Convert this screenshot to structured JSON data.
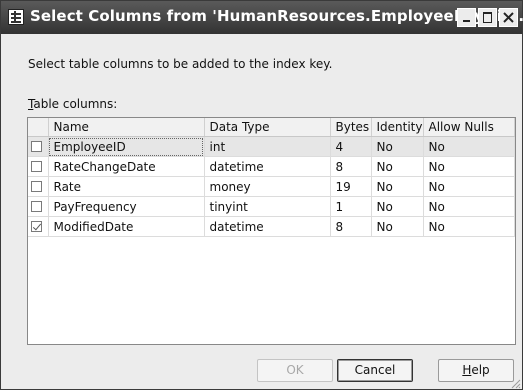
{
  "window": {
    "title": "Select Columns from 'HumanResources.EmployeePayHist..."
  },
  "instruction": "Select table columns to be added to the index key.",
  "table_label": {
    "accel": "T",
    "rest": "able columns:"
  },
  "grid": {
    "headers": [
      "",
      "Name",
      "Data Type",
      "Bytes",
      "Identity",
      "Allow Nulls"
    ],
    "rows": [
      {
        "checked": false,
        "name": "EmployeeID",
        "type": "int",
        "bytes": "4",
        "identity": "No",
        "nulls": "No"
      },
      {
        "checked": false,
        "name": "RateChangeDate",
        "type": "datetime",
        "bytes": "8",
        "identity": "No",
        "nulls": "No"
      },
      {
        "checked": false,
        "name": "Rate",
        "type": "money",
        "bytes": "19",
        "identity": "No",
        "nulls": "No"
      },
      {
        "checked": false,
        "name": "PayFrequency",
        "type": "tinyint",
        "bytes": "1",
        "identity": "No",
        "nulls": "No"
      },
      {
        "checked": true,
        "name": "ModifiedDate",
        "type": "datetime",
        "bytes": "8",
        "identity": "No",
        "nulls": "No"
      }
    ]
  },
  "buttons": {
    "ok": "OK",
    "cancel": "Cancel",
    "help_accel": "H",
    "help_rest": "elp"
  }
}
